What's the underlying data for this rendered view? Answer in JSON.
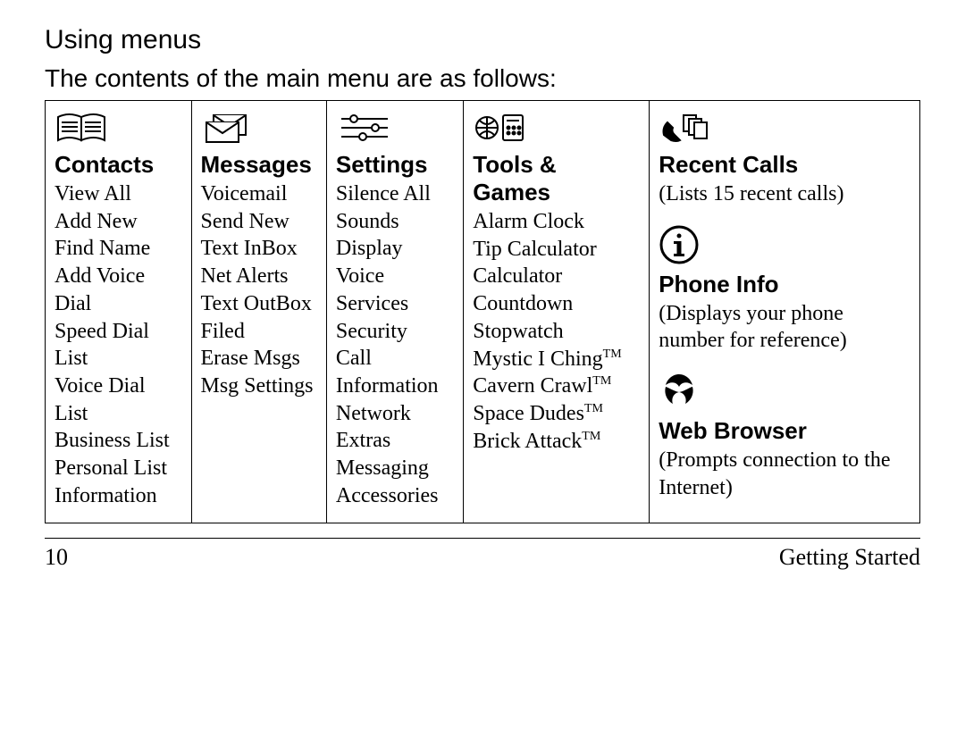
{
  "section_title": "Using menus",
  "intro": "The contents of the main menu are as follows:",
  "columns": [
    {
      "heading": "Contacts",
      "items": [
        "View All",
        "Add New",
        "Find Name",
        "Add Voice",
        "Dial",
        "Speed Dial",
        "List",
        "Voice Dial",
        "List",
        "Business List",
        "Personal List",
        "Information"
      ]
    },
    {
      "heading": "Messages",
      "items": [
        "Voicemail",
        "Send New",
        "Text InBox",
        "Net Alerts",
        "Text OutBox",
        "Filed",
        "Erase Msgs",
        "Msg Settings"
      ]
    },
    {
      "heading": "Settings",
      "items": [
        "Silence All",
        "Sounds",
        "Display",
        "Voice",
        "Services",
        "Security",
        "Call",
        "Information",
        "Network",
        "Extras",
        "Messaging",
        "Accessories"
      ]
    },
    {
      "heading": "Tools & Games",
      "items": [
        "Alarm Clock",
        "Tip Calculator",
        "Calculator",
        "Countdown",
        "Stopwatch"
      ],
      "tm_items": [
        "Mystic I Ching",
        "Cavern Crawl",
        "Space Dudes",
        "Brick Attack"
      ],
      "tm_suffix": "TM"
    }
  ],
  "right": {
    "recent_calls": {
      "heading": "Recent Calls",
      "desc": "(Lists 15 recent calls)"
    },
    "phone_info": {
      "heading": "Phone Info",
      "desc": "(Displays your phone number for reference)"
    },
    "web_browser": {
      "heading": "Web Browser",
      "desc": "(Prompts connection to the Internet)"
    }
  },
  "footer": {
    "page_number": "10",
    "chapter": "Getting Started"
  }
}
